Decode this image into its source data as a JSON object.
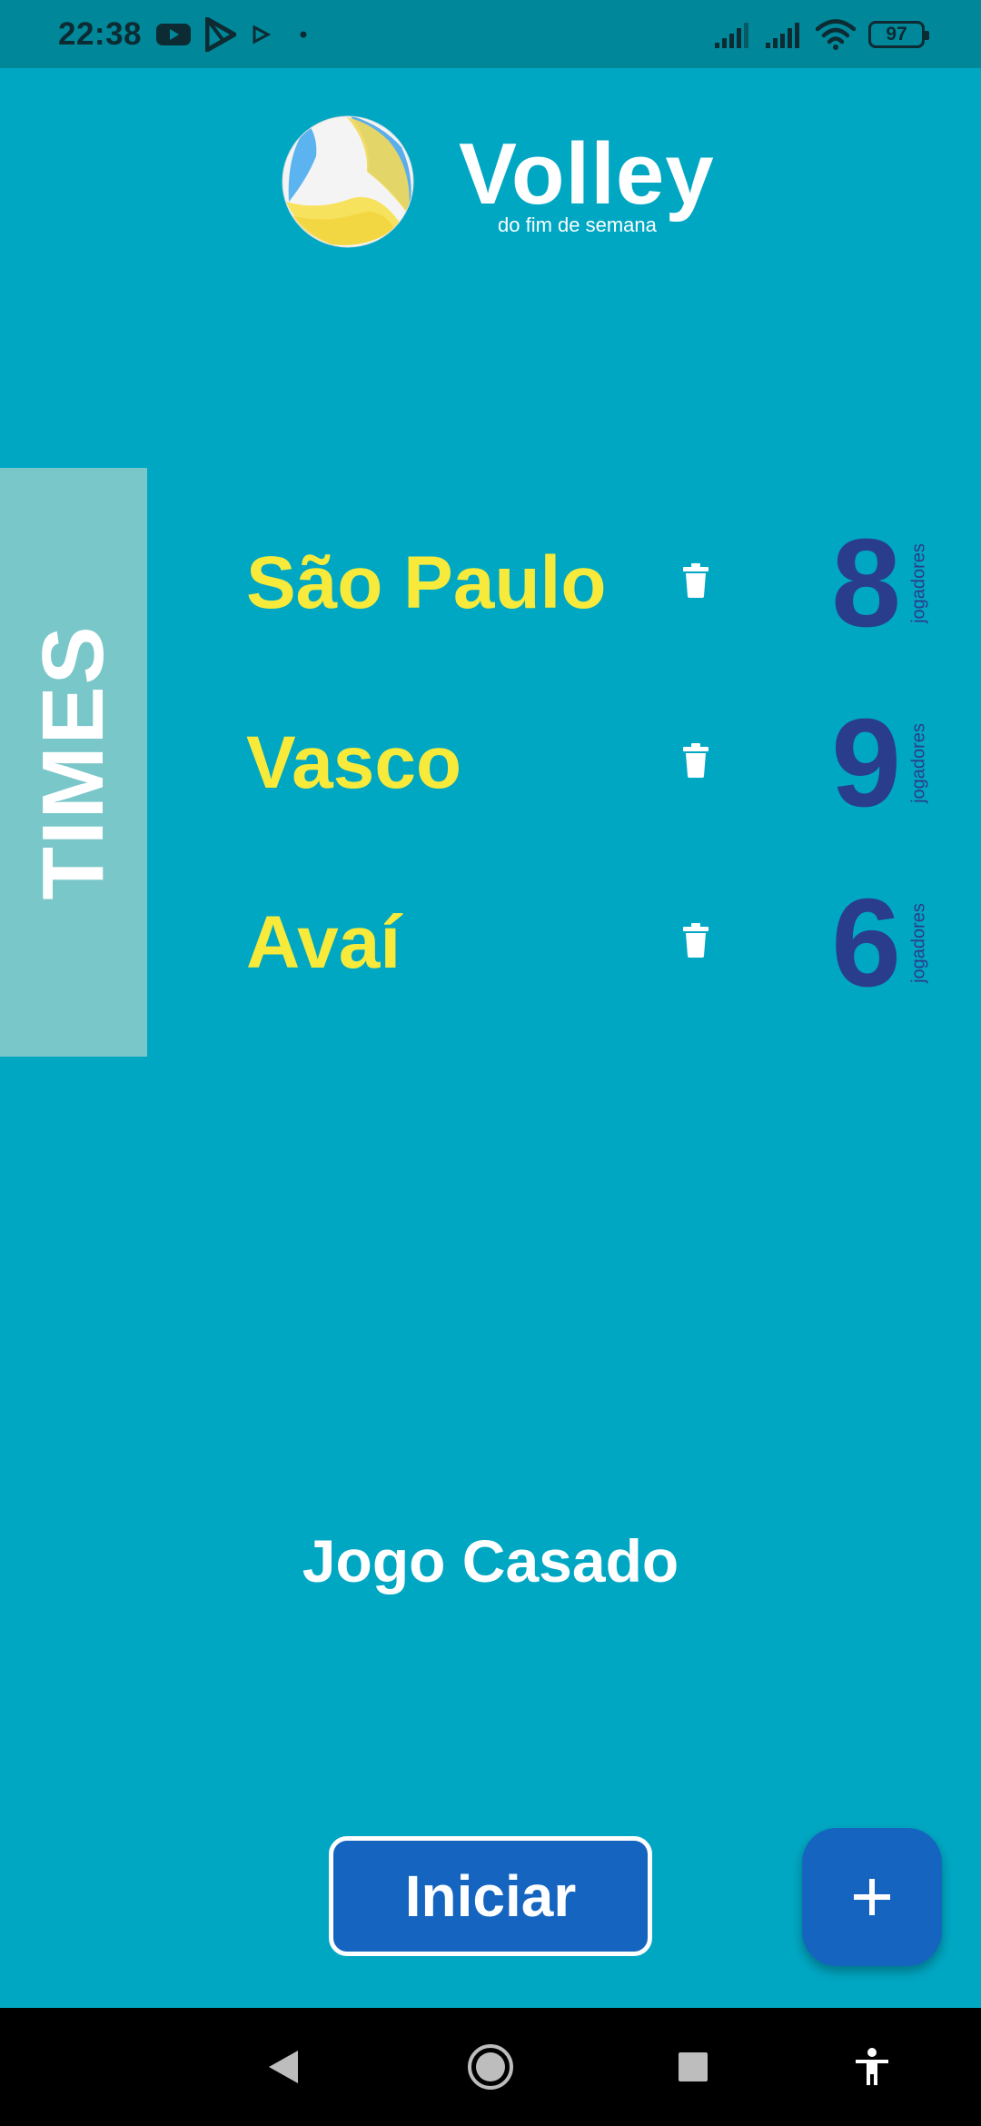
{
  "status_bar": {
    "time": "22:38",
    "notification_icons": [
      "youtube-icon",
      "play-store-icon",
      "play-icon",
      "dot-icon"
    ],
    "battery": "97"
  },
  "header": {
    "title": "Volley",
    "subtitle": "do fim de semana"
  },
  "side_tab": {
    "label": "TIMES"
  },
  "teams": [
    {
      "name": "São Paulo",
      "count": "8",
      "count_label": "jogadores"
    },
    {
      "name": "Vasco",
      "count": "9",
      "count_label": "jogadores"
    },
    {
      "name": "Avaí",
      "count": "6",
      "count_label": "jogadores"
    }
  ],
  "game_mode": "Jogo Casado",
  "actions": {
    "start_label": "Iniciar",
    "add_label": "+"
  },
  "colors": {
    "background": "#00a7c3",
    "status_bar": "#008799",
    "team_name": "#f7ea3a",
    "player_count": "#2a3c8c",
    "button": "#1565c0",
    "side_tab": "#79c7c9"
  }
}
